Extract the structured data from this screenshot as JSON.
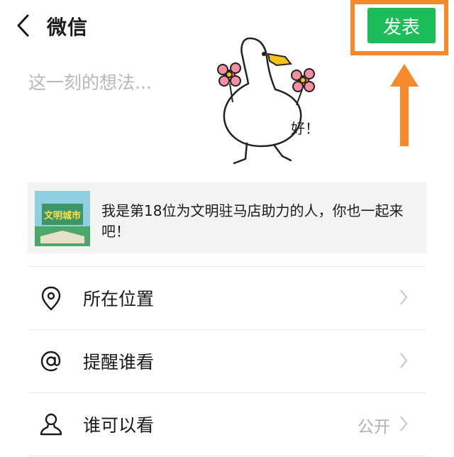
{
  "header": {
    "title": "微信",
    "post_label": "发表"
  },
  "composer": {
    "placeholder": "这一刻的想法..."
  },
  "sticker": {
    "caption": "好！"
  },
  "share_card": {
    "thumb_text": "文明城市",
    "text": "我是第18位为文明驻马店助力的人，你也一起来吧！"
  },
  "options": {
    "location": {
      "label": "所在位置",
      "icon": "location-pin-icon"
    },
    "mention": {
      "label": "提醒谁看",
      "icon": "at-icon"
    },
    "visibility": {
      "label": "谁可以看",
      "value": "公开",
      "icon": "person-icon"
    }
  },
  "colors": {
    "accent": "#1cbe5a",
    "annotation": "#f58a2b",
    "placeholder": "#b8b8b8",
    "card_bg": "#f3f3f3"
  }
}
